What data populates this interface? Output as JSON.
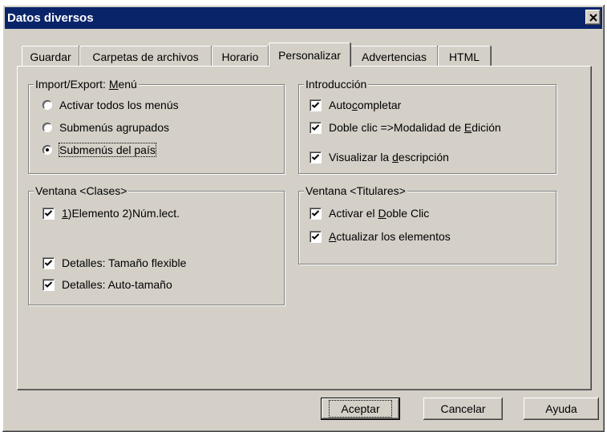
{
  "window": {
    "title": "Datos diversos",
    "close_label": "×"
  },
  "tabs": [
    {
      "label": "Guardar",
      "active": false
    },
    {
      "label": "Carpetas de archivos",
      "active": false
    },
    {
      "label": "Horario",
      "active": false
    },
    {
      "label": "Personalizar",
      "active": true
    },
    {
      "label": "Advertencias",
      "active": false
    },
    {
      "label": "HTML",
      "active": false
    }
  ],
  "import_export": {
    "title_prefix": "Import/Export: ",
    "title_underlined": "M",
    "title_suffix": "enú",
    "options": [
      {
        "label": "Activar todos los menús",
        "checked": false
      },
      {
        "label": "Submenús agrupados",
        "checked": false
      },
      {
        "label": "Submenús del país",
        "checked": true
      }
    ]
  },
  "introduccion": {
    "title": "Introducción",
    "items": [
      {
        "pre": "Auto",
        "u": "c",
        "post": "ompletar",
        "checked": true
      },
      {
        "pre": "Doble clic =>Modalidad de ",
        "u": "E",
        "post": "dición",
        "checked": true
      },
      {
        "pre": "Visualizar la ",
        "u": "d",
        "post": "escripción",
        "checked": true
      }
    ]
  },
  "ventana_clases": {
    "title": "Ventana <Clases>",
    "items": [
      {
        "pre": "",
        "u": "1",
        "post": ")Elemento 2)Núm.lect.",
        "checked": true
      },
      {
        "pre": "Detalles: Tamaño flexible",
        "u": "",
        "post": "",
        "checked": true
      },
      {
        "pre": "Detalles: Auto-tamaño",
        "u": "",
        "post": "",
        "checked": true
      }
    ]
  },
  "ventana_titulares": {
    "title": "Ventana <Titulares>",
    "items": [
      {
        "pre": "Activar el ",
        "u": "D",
        "post": "oble Clic",
        "checked": true
      },
      {
        "pre": "",
        "u": "A",
        "post": "ctualizar los elementos",
        "checked": true
      }
    ]
  },
  "buttons": {
    "ok": "Aceptar",
    "cancel": "Cancelar",
    "help": "Ayuda"
  }
}
